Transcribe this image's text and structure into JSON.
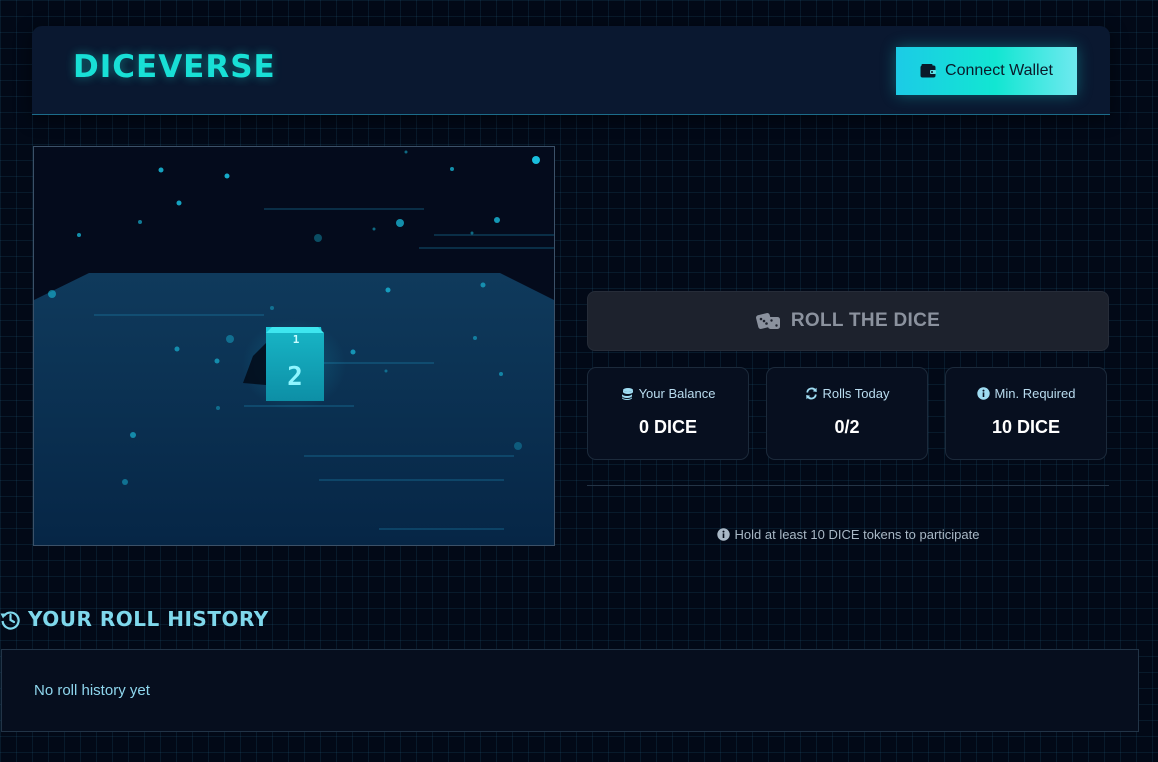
{
  "header": {
    "logo": "DICEVERSE",
    "connect_wallet_label": "Connect Wallet"
  },
  "icons": {
    "wallet": "wallet-icon",
    "dice": "dice-icon",
    "coins": "coins-icon",
    "refresh": "refresh-icon",
    "info": "info-icon",
    "history": "history-icon"
  },
  "scene": {
    "die_top_face": "1",
    "die_front_face": "2"
  },
  "roll_button": {
    "label": "ROLL THE DICE"
  },
  "stats": [
    {
      "label": "Your Balance",
      "value": "0 DICE"
    },
    {
      "label": "Rolls Today",
      "value": "0/2"
    },
    {
      "label": "Min. Required",
      "value": "10 DICE"
    }
  ],
  "note": "Hold at least 10 DICE tokens to participate",
  "history": {
    "title": "YOUR ROLL HISTORY",
    "empty_text": "No roll history yet"
  },
  "colors": {
    "accent": "#18e0d6",
    "background": "#020917",
    "panel": "#0a1830",
    "disabled": "#1d222d"
  }
}
